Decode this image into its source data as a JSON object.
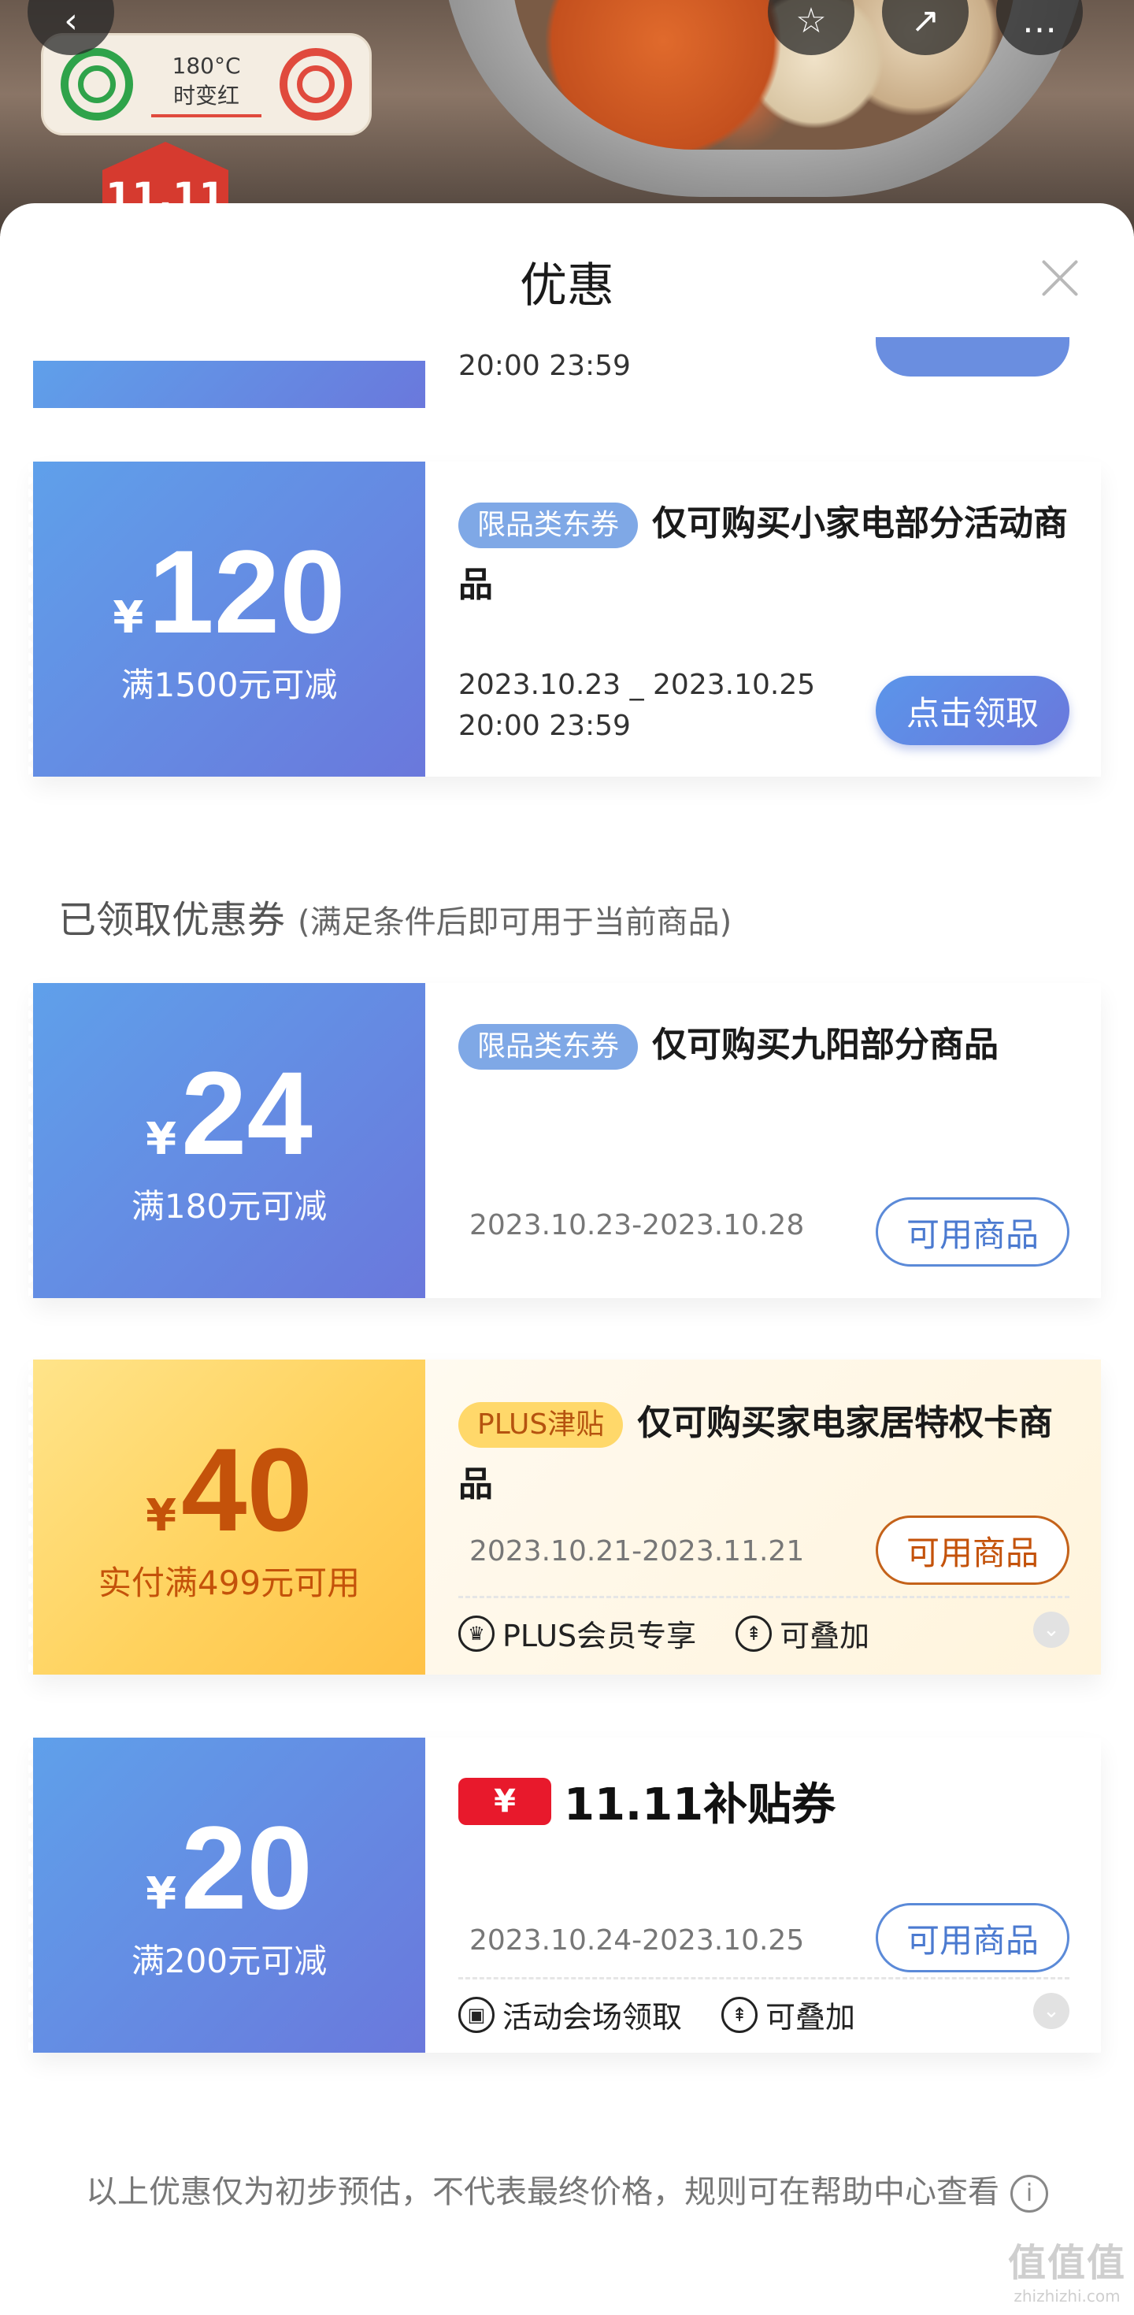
{
  "background": {
    "badge_line1": "180°C",
    "badge_line2": "时变红",
    "promo_flag": "11.11",
    "nav": {
      "back": "‹",
      "star": "☆",
      "share": "↗",
      "more": "…"
    }
  },
  "sheet": {
    "title": "优惠",
    "partial_coupon_date": "20:00 23:59",
    "coupons_top": [
      {
        "yen": "¥",
        "amount": "120",
        "condition": "满1500元可减",
        "tag": "限品类东券",
        "title": "仅可购买小家电部分活动商品",
        "date_line1": "2023.10.23 _ 2023.10.25",
        "date_line2": "20:00 23:59",
        "button": "点击领取"
      }
    ],
    "claimed_section": {
      "title": "已领取优惠券",
      "note": "(满足条件后即可用于当前商品)"
    },
    "claimed": [
      {
        "yen": "¥",
        "amount": "24",
        "condition": "满180元可减",
        "tag": "限品类东券",
        "title": "仅可购买九阳部分商品",
        "date": "2023.10.23-2023.10.28",
        "button": "可用商品"
      },
      {
        "yen": "¥",
        "amount": "40",
        "condition": "实付满499元可用",
        "tag": "PLUS津贴",
        "title": "仅可购买家电家居特权卡商品",
        "date": "2023.10.21-2023.11.21",
        "button": "可用商品",
        "feature1": "PLUS会员专享",
        "feature2": "可叠加"
      },
      {
        "yen": "¥",
        "amount": "20",
        "condition": "满200元可减",
        "logo_symbol": "¥",
        "logo_text": "11.11补贴券",
        "date": "2023.10.24-2023.10.25",
        "button": "可用商品",
        "feature1": "活动会场领取",
        "feature2": "可叠加"
      }
    ],
    "footer_note": "以上优惠仅为初步预估，不代表最终价格，规则可在帮助中心查看",
    "watermark_line1": "值值值",
    "watermark_line2": "zhizhizhi.com"
  },
  "colors": {
    "blue_gradient_start": "#5fa0ea",
    "blue_gradient_end": "#6a78dc",
    "gold": "#ffd25e",
    "gold_text": "#c4520a",
    "subsidy_red": "#e8192c"
  }
}
